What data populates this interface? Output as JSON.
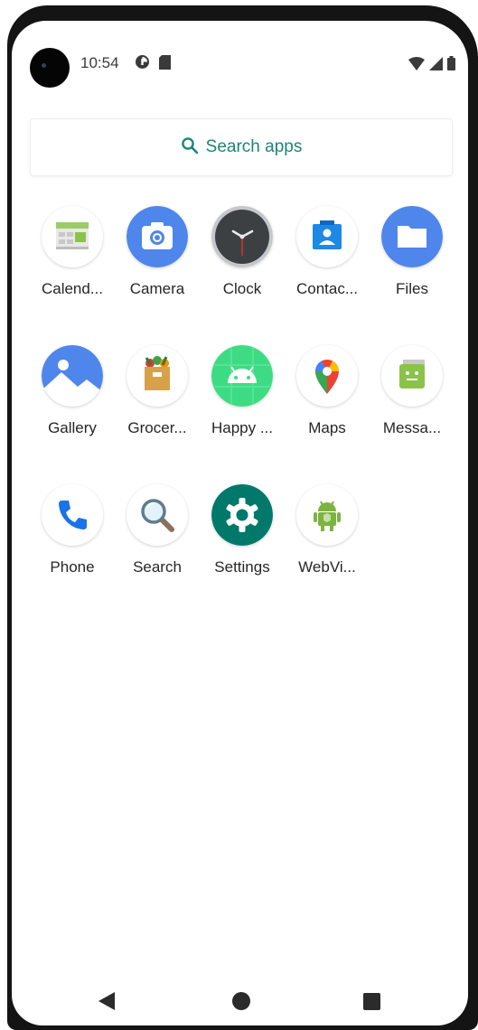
{
  "status_bar": {
    "time": "10:54",
    "icons": [
      "data-saver-icon",
      "sd-card-icon",
      "wifi-icon",
      "signal-icon",
      "battery-icon"
    ]
  },
  "search": {
    "label": "Search apps",
    "accent_color": "#1b857a"
  },
  "apps": [
    {
      "label": "Calend...",
      "icon": "calendar-icon"
    },
    {
      "label": "Camera",
      "icon": "camera-icon"
    },
    {
      "label": "Clock",
      "icon": "clock-icon"
    },
    {
      "label": "Contac...",
      "icon": "contacts-icon"
    },
    {
      "label": "Files",
      "icon": "files-icon"
    },
    {
      "label": "Gallery",
      "icon": "gallery-icon"
    },
    {
      "label": "Grocer...",
      "icon": "grocery-icon"
    },
    {
      "label": "Happy ...",
      "icon": "android-icon"
    },
    {
      "label": "Maps",
      "icon": "maps-icon"
    },
    {
      "label": "Messa...",
      "icon": "messages-icon"
    },
    {
      "label": "Phone",
      "icon": "phone-icon"
    },
    {
      "label": "Search",
      "icon": "search-magnifier-icon"
    },
    {
      "label": "Settings",
      "icon": "settings-icon"
    },
    {
      "label": "WebVi...",
      "icon": "webview-icon"
    }
  ],
  "nav_bar": {
    "buttons": [
      "back-icon",
      "home-icon",
      "recents-icon"
    ]
  }
}
